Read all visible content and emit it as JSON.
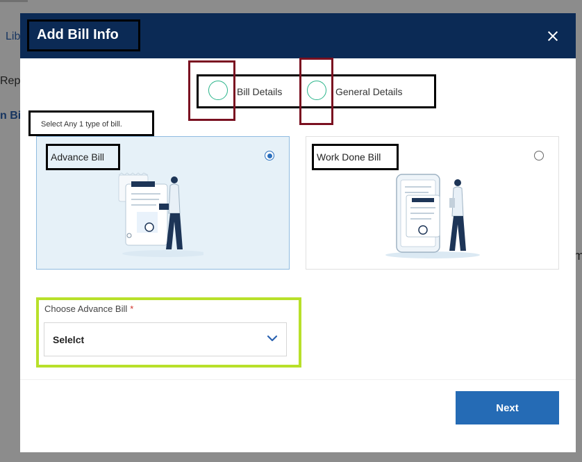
{
  "background": {
    "fragment_1": "Lib",
    "fragment_2": "Rep",
    "fragment_3": "n Bil",
    "fragment_4": "m"
  },
  "modal": {
    "title": "Add Bill Info"
  },
  "stepper": {
    "steps": [
      {
        "label": "Bill Details"
      },
      {
        "label": "General Details"
      }
    ]
  },
  "hint": "Select Any 1 type of bill.",
  "cards": [
    {
      "label": "Advance Bill",
      "selected": true
    },
    {
      "label": "Work Done Bill",
      "selected": false
    }
  ],
  "choose_field": {
    "label": "Choose Advance Bill",
    "required_marker": "*",
    "value": "Selelct"
  },
  "footer": {
    "next_label": "Next"
  },
  "colors": {
    "header_bg": "#0b2a55",
    "accent": "#256bb5",
    "step_circle": "#2bb58b",
    "highlight_green": "#b8e02a",
    "highlight_red": "#7a1020"
  }
}
